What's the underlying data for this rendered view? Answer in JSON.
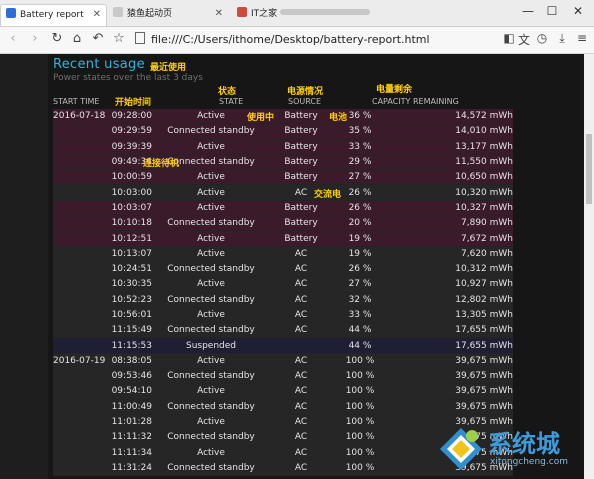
{
  "browser": {
    "tabs": [
      {
        "label": "Battery report"
      },
      {
        "label": "猿鱼起动页"
      },
      {
        "label": "IT之家"
      }
    ],
    "url": "file:///C:/Users/ithome/Desktop/battery-report.html"
  },
  "report": {
    "title": "Recent usage",
    "subtitle": "Power states over the last 3 days",
    "columns": {
      "start_time": "START TIME",
      "state": "STATE",
      "source": "SOURCE",
      "capacity": "CAPACITY REMAINING"
    },
    "annotations": {
      "title": "最近使用",
      "start_time": "开始时间",
      "state": "状态",
      "source": "电源情况",
      "capacity": "电量剩余",
      "active": "使用中",
      "battery": "电池",
      "standby": "连接待机",
      "ac": "交流电"
    },
    "rows": [
      {
        "date": "2016-07-18",
        "time": "09:28:00",
        "state": "Active",
        "source": "Battery",
        "pct": "36 %",
        "cap": "14,572 mWh",
        "kind": "batt"
      },
      {
        "date": "",
        "time": "09:29:59",
        "state": "Connected standby",
        "source": "Battery",
        "pct": "35 %",
        "cap": "14,010 mWh",
        "kind": "batt"
      },
      {
        "date": "",
        "time": "09:39:39",
        "state": "Active",
        "source": "Battery",
        "pct": "33 %",
        "cap": "13,177 mWh",
        "kind": "batt"
      },
      {
        "date": "",
        "time": "09:49:34",
        "state": "Connected standby",
        "source": "Battery",
        "pct": "29 %",
        "cap": "11,550 mWh",
        "kind": "batt"
      },
      {
        "date": "",
        "time": "10:00:59",
        "state": "Active",
        "source": "Battery",
        "pct": "27 %",
        "cap": "10,650 mWh",
        "kind": "batt"
      },
      {
        "date": "",
        "time": "10:03:00",
        "state": "Active",
        "source": "AC",
        "pct": "26 %",
        "cap": "10,320 mWh",
        "kind": "ac"
      },
      {
        "date": "",
        "time": "10:03:07",
        "state": "Active",
        "source": "Battery",
        "pct": "26 %",
        "cap": "10,327 mWh",
        "kind": "batt"
      },
      {
        "date": "",
        "time": "10:10:18",
        "state": "Connected standby",
        "source": "Battery",
        "pct": "20 %",
        "cap": "7,890 mWh",
        "kind": "batt"
      },
      {
        "date": "",
        "time": "10:12:51",
        "state": "Active",
        "source": "Battery",
        "pct": "19 %",
        "cap": "7,672 mWh",
        "kind": "batt"
      },
      {
        "date": "",
        "time": "10:13:07",
        "state": "Active",
        "source": "AC",
        "pct": "19 %",
        "cap": "7,620 mWh",
        "kind": "ac"
      },
      {
        "date": "",
        "time": "10:24:51",
        "state": "Connected standby",
        "source": "AC",
        "pct": "26 %",
        "cap": "10,312 mWh",
        "kind": "ac"
      },
      {
        "date": "",
        "time": "10:30:35",
        "state": "Active",
        "source": "AC",
        "pct": "27 %",
        "cap": "10,927 mWh",
        "kind": "ac"
      },
      {
        "date": "",
        "time": "10:52:23",
        "state": "Connected standby",
        "source": "AC",
        "pct": "32 %",
        "cap": "12,802 mWh",
        "kind": "ac"
      },
      {
        "date": "",
        "time": "10:56:01",
        "state": "Active",
        "source": "AC",
        "pct": "33 %",
        "cap": "13,305 mWh",
        "kind": "ac"
      },
      {
        "date": "",
        "time": "11:15:49",
        "state": "Connected standby",
        "source": "AC",
        "pct": "44 %",
        "cap": "17,655 mWh",
        "kind": "ac"
      },
      {
        "date": "",
        "time": "11:15:53",
        "state": "Suspended",
        "source": "",
        "pct": "44 %",
        "cap": "17,655 mWh",
        "kind": "susp"
      },
      {
        "date": "2016-07-19",
        "time": "08:38:05",
        "state": "Active",
        "source": "AC",
        "pct": "100 %",
        "cap": "39,675 mWh",
        "kind": "ac"
      },
      {
        "date": "",
        "time": "09:53:46",
        "state": "Connected standby",
        "source": "AC",
        "pct": "100 %",
        "cap": "39,675 mWh",
        "kind": "ac"
      },
      {
        "date": "",
        "time": "09:54:10",
        "state": "Active",
        "source": "AC",
        "pct": "100 %",
        "cap": "39,675 mWh",
        "kind": "ac"
      },
      {
        "date": "",
        "time": "11:00:49",
        "state": "Connected standby",
        "source": "AC",
        "pct": "100 %",
        "cap": "39,675 mWh",
        "kind": "ac"
      },
      {
        "date": "",
        "time": "11:01:28",
        "state": "Active",
        "source": "AC",
        "pct": "100 %",
        "cap": "39,675 mWh",
        "kind": "ac"
      },
      {
        "date": "",
        "time": "11:11:32",
        "state": "Connected standby",
        "source": "AC",
        "pct": "100 %",
        "cap": "39,675 mWh",
        "kind": "ac"
      },
      {
        "date": "",
        "time": "11:11:34",
        "state": "Active",
        "source": "AC",
        "pct": "100 %",
        "cap": "39,675 mWh",
        "kind": "ac"
      },
      {
        "date": "",
        "time": "11:31:24",
        "state": "Connected standby",
        "source": "AC",
        "pct": "100 %",
        "cap": "39,675 mWh",
        "kind": "ac"
      }
    ]
  },
  "watermark": {
    "text": "系统城",
    "sub": "xitongcheng.com"
  },
  "colors": {
    "title": "#2fb6d8",
    "annotation": "#ffd000",
    "battery_row": "#3b1b2b",
    "ac_row": "#262626"
  }
}
